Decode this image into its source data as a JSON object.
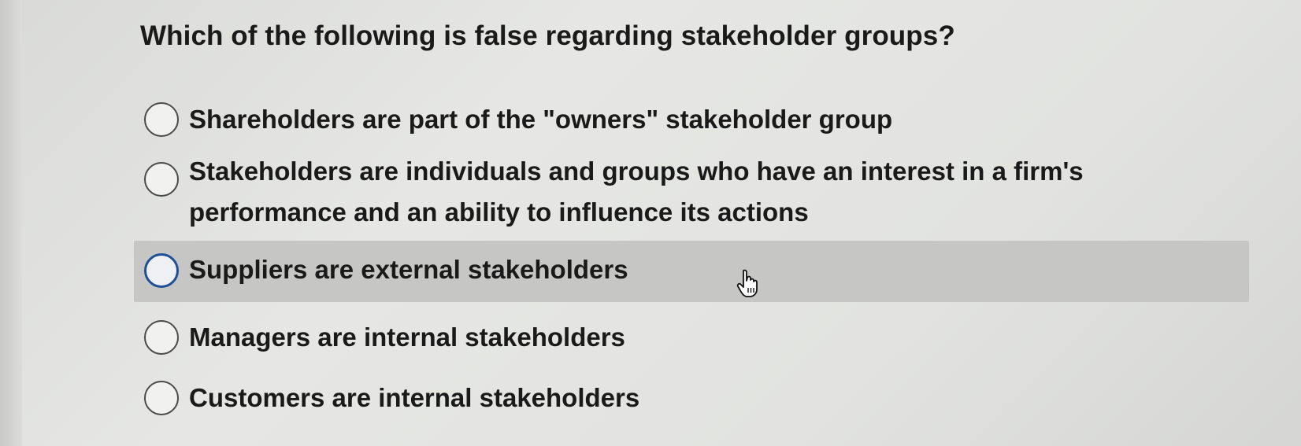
{
  "question": {
    "text": "Which of the following is false regarding stakeholder groups?"
  },
  "options": [
    {
      "label": "Shareholders are part of the \"owners\" stakeholder group",
      "selected": false,
      "hovered": false
    },
    {
      "label": "Stakeholders are individuals and groups who have an interest in a firm's performance and an ability to influence its actions",
      "selected": false,
      "hovered": false
    },
    {
      "label": "Suppliers are external stakeholders",
      "selected": false,
      "hovered": true
    },
    {
      "label": "Managers are internal stakeholders",
      "selected": false,
      "hovered": false
    },
    {
      "label": "Customers are internal stakeholders",
      "selected": false,
      "hovered": false
    }
  ],
  "cursor": {
    "icon": "hand-pointer-icon"
  },
  "colors": {
    "background": "#e2e3e0",
    "hover_row": "#c6c7c4",
    "focus_ring": "#1f4f96",
    "text": "#1a1a1a"
  }
}
